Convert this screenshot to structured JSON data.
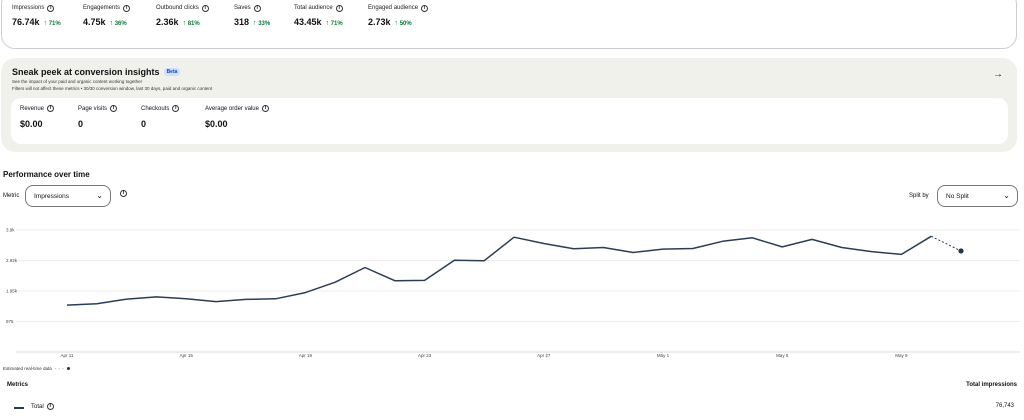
{
  "top_metrics": [
    {
      "label": "Impressions",
      "value": "76.74k",
      "change": "71%"
    },
    {
      "label": "Engagements",
      "value": "4.75k",
      "change": "36%"
    },
    {
      "label": "Outbound clicks",
      "value": "2.36k",
      "change": "81%"
    },
    {
      "label": "Saves",
      "value": "318",
      "change": "33%"
    },
    {
      "label": "Total audience",
      "value": "43.45k",
      "change": "71%"
    },
    {
      "label": "Engaged audience",
      "value": "2.73k",
      "change": "50%"
    }
  ],
  "sneak_peek": {
    "title": "Sneak peek at conversion insights",
    "badge": "Beta",
    "subtitle": "See the impact of your paid and organic content working together",
    "note": "Filters will not affect these metrics • 30/30 conversion window, last 30 days, paid and organic content",
    "metrics": [
      {
        "label": "Revenue",
        "value": "$0.00"
      },
      {
        "label": "Page visits",
        "value": "0"
      },
      {
        "label": "Checkouts",
        "value": "0"
      },
      {
        "label": "Average order value",
        "value": "$0.00"
      }
    ]
  },
  "performance": {
    "title": "Performance over time",
    "metric_label": "Metric",
    "metric_value": "Impressions",
    "split_label": "Split by",
    "split_value": "No Split",
    "estimated_label": "Estimated real-time data"
  },
  "chart_data": {
    "type": "line",
    "series": [
      {
        "values": [
          1500,
          1540,
          1690,
          1760,
          1700,
          1610,
          1680,
          1700,
          1900,
          2230,
          2700,
          2280,
          2290,
          2930,
          2920,
          3670,
          3470,
          3300,
          3340,
          3180,
          3290,
          3310,
          3540,
          3650,
          3360,
          3600,
          3340,
          3210,
          3120,
          3700
        ]
      }
    ],
    "estimate_value": 3230,
    "x_tick_labels": [
      "Apr 11",
      "Apr 15",
      "Apr 19",
      "Apr 23",
      "Apr 27",
      "May 1",
      "May 5",
      "May 9"
    ],
    "y_tick_labels": [
      "3.9k",
      "2.92k",
      "1.95k",
      "975"
    ],
    "ylim": [
      0,
      3900
    ],
    "grid": true
  },
  "table": {
    "col_metric": "Metrics",
    "col_total": "Total impressions",
    "rows": [
      {
        "label": "Total",
        "value": "76,743"
      }
    ]
  },
  "colors": {
    "line": "#2b3d55",
    "positive": "#0a7a39",
    "peek_bg": "#f1f1ec"
  }
}
